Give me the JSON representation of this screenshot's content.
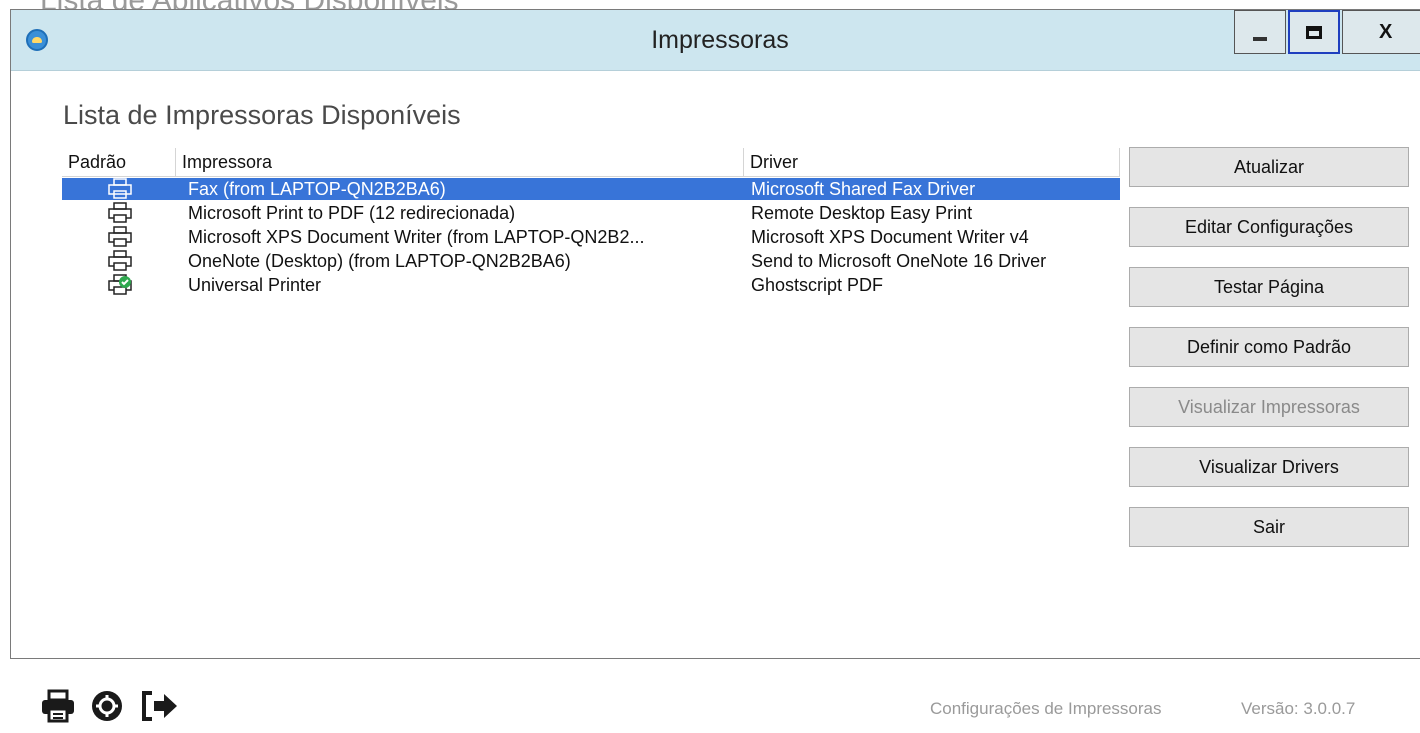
{
  "background_window": {
    "title": "Lista de Aplicativos Disponíveis"
  },
  "window": {
    "title": "Impressoras",
    "controls": {
      "minimize": "minimize",
      "maximize": "maximize",
      "close": "X"
    }
  },
  "section_title": "Lista de Impressoras Disponíveis",
  "columns": [
    "Padrão",
    "Impressora",
    "Driver"
  ],
  "printers": [
    {
      "name": "Fax (from LAPTOP-QN2B2BA6)",
      "driver": "Microsoft Shared Fax Driver",
      "icon": "printer-icon",
      "default": false,
      "selected": true
    },
    {
      "name": "Microsoft Print to PDF (12 redirecionada)",
      "driver": "Remote Desktop Easy Print",
      "icon": "printer-icon",
      "default": false,
      "selected": false
    },
    {
      "name": "Microsoft XPS Document Writer (from LAPTOP-QN2B2...",
      "driver": "Microsoft XPS Document Writer v4",
      "icon": "printer-icon",
      "default": false,
      "selected": false
    },
    {
      "name": "OneNote (Desktop) (from LAPTOP-QN2B2BA6)",
      "driver": "Send to Microsoft OneNote 16 Driver",
      "icon": "printer-icon",
      "default": false,
      "selected": false
    },
    {
      "name": "Universal Printer",
      "driver": "Ghostscript PDF",
      "icon": "default-printer-check-icon",
      "default": true,
      "selected": false
    }
  ],
  "buttons": [
    {
      "label": "Atualizar",
      "enabled": true
    },
    {
      "label": "Editar Configurações",
      "enabled": true
    },
    {
      "label": "Testar Página",
      "enabled": true
    },
    {
      "label": "Definir como Padrão",
      "enabled": true
    },
    {
      "label": "Visualizar Impressoras",
      "enabled": false
    },
    {
      "label": "Visualizar Drivers",
      "enabled": true
    },
    {
      "label": "Sair",
      "enabled": true
    }
  ],
  "footer": {
    "icons": [
      "printer-icon",
      "gear-icon",
      "exit-arrow-icon"
    ],
    "status": "Configurações de Impressoras",
    "version": "Versão: 3.0.0.7"
  },
  "colors": {
    "titlebar": "#cde6ef",
    "selection": "#3874d8",
    "button_bg": "#e5e5e5",
    "disabled_text": "#8a8a8a"
  }
}
